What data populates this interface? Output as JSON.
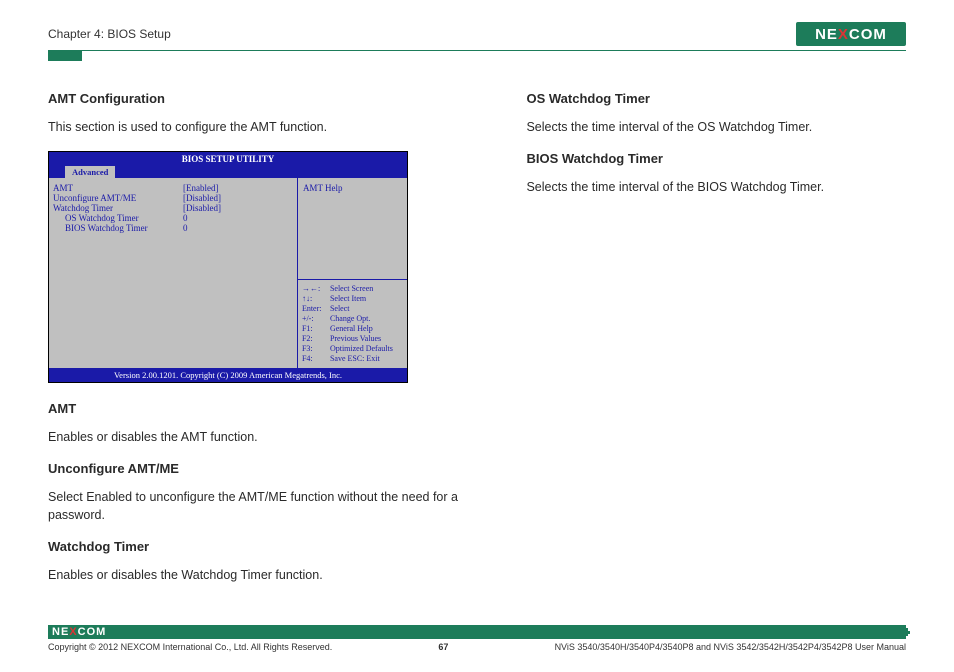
{
  "header": {
    "chapter": "Chapter 4: BIOS Setup",
    "brand_parts": {
      "a": "NE",
      "x": "X",
      "b": "COM"
    }
  },
  "left": {
    "h1": "AMT Configuration",
    "p1": "This section is used to configure the AMT function.",
    "h2": "AMT",
    "p2": "Enables or disables the AMT function.",
    "h3": "Unconfigure AMT/ME",
    "p3": "Select Enabled to unconfigure the AMT/ME function without the need for a password.",
    "h4": "Watchdog Timer",
    "p4": "Enables or disables the Watchdog Timer function."
  },
  "right": {
    "h1": "OS Watchdog Timer",
    "p1": "Selects the time interval of the OS Watchdog Timer.",
    "h2": "BIOS Watchdog Timer",
    "p2": "Selects the time interval of the BIOS Watchdog Timer."
  },
  "bios": {
    "title": "BIOS SETUP UTILITY",
    "tab_blank": " ",
    "tab_active": "Advanced",
    "rows": [
      {
        "lbl": "AMT",
        "val": "[Enabled]"
      },
      {
        "lbl": "Unconfigure AMT/ME",
        "val": "[Disabled]"
      },
      {
        "lbl": "Watchdog Timer",
        "val": "[Disabled]"
      },
      {
        "lbl": "OS Watchdog Timer",
        "val": "0",
        "indent": true
      },
      {
        "lbl": "BIOS Watchdog Timer",
        "val": "0",
        "indent": true
      }
    ],
    "help": "AMT Help",
    "keys": [
      {
        "k": "→←:",
        "d": "Select Screen"
      },
      {
        "k": "↑↓:",
        "d": "Select Item"
      },
      {
        "k": "Enter:",
        "d": "Select"
      },
      {
        "k": "+/-:",
        "d": "Change Opt."
      },
      {
        "k": "F1:",
        "d": "General Help"
      },
      {
        "k": "F2:",
        "d": "Previous Values"
      },
      {
        "k": "F3:",
        "d": "Optimized Defaults"
      },
      {
        "k": "F4:",
        "d": "Save   ESC: Exit"
      }
    ],
    "footer": "Version 2.00.1201. Copyright (C) 2009 American Megatrends, Inc."
  },
  "footer": {
    "copyright": "Copyright © 2012 NEXCOM International Co., Ltd. All Rights Reserved.",
    "page": "67",
    "manual": "NViS 3540/3540H/3540P4/3540P8 and NViS 3542/3542H/3542P4/3542P8 User Manual"
  }
}
